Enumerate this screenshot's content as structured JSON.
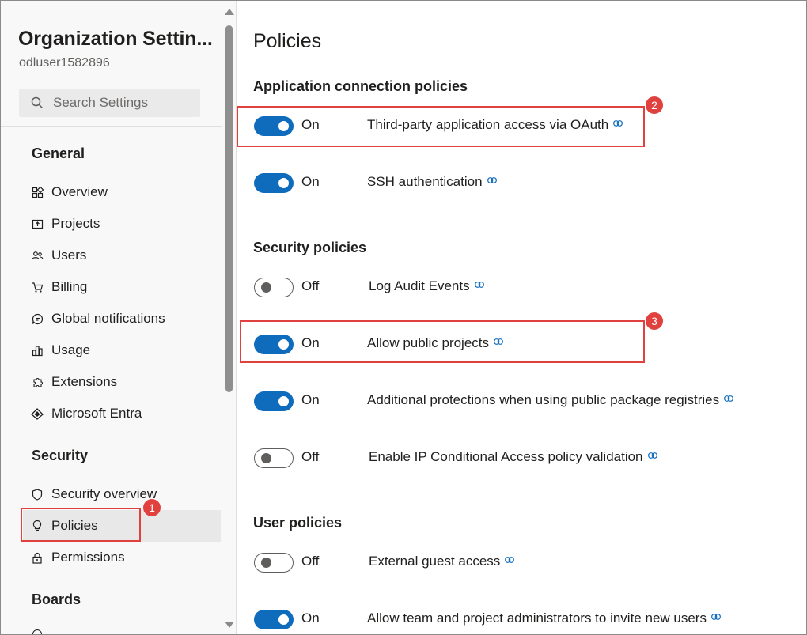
{
  "sidebar": {
    "org_title": "Organization Settin...",
    "org_user": "odluser1582896",
    "search_placeholder": "Search Settings",
    "sections": {
      "general": "General",
      "security": "Security",
      "boards": "Boards"
    },
    "general_items": [
      {
        "label": "Overview",
        "icon": "overview-icon"
      },
      {
        "label": "Projects",
        "icon": "projects-icon"
      },
      {
        "label": "Users",
        "icon": "users-icon"
      },
      {
        "label": "Billing",
        "icon": "cart-icon"
      },
      {
        "label": "Global notifications",
        "icon": "chat-icon"
      },
      {
        "label": "Usage",
        "icon": "usage-icon"
      },
      {
        "label": "Extensions",
        "icon": "puzzle-icon"
      },
      {
        "label": "Microsoft Entra",
        "icon": "entra-icon"
      }
    ],
    "security_items": [
      {
        "label": "Security overview",
        "icon": "shield-icon"
      },
      {
        "label": "Policies",
        "icon": "lightbulb-icon",
        "selected": true
      },
      {
        "label": "Permissions",
        "icon": "lock-icon"
      }
    ]
  },
  "main": {
    "title": "Policies",
    "groups": {
      "application": "Application connection policies",
      "security": "Security policies",
      "user": "User policies"
    },
    "policies": {
      "oauth": {
        "state": "On",
        "label": "Third-party application access via OAuth"
      },
      "ssh": {
        "state": "On",
        "label": "SSH authentication"
      },
      "audit": {
        "state": "Off",
        "label": "Log Audit Events"
      },
      "public_projects": {
        "state": "On",
        "label": "Allow public projects"
      },
      "package_registries": {
        "state": "On",
        "label": "Additional protections when using public package registries"
      },
      "ip_conditional": {
        "state": "Off",
        "label": "Enable IP Conditional Access policy validation"
      },
      "guest_access": {
        "state": "Off",
        "label": "External guest access"
      },
      "invite_users": {
        "state": "On",
        "label": "Allow team and project administrators to invite new users"
      }
    }
  },
  "annotations": {
    "badge1": "1",
    "badge2": "2",
    "badge3": "3"
  },
  "colors": {
    "toggle_on": "#0f6cbd",
    "annotation": "#e0403e",
    "sidebar_bg": "#f8f8f8"
  }
}
